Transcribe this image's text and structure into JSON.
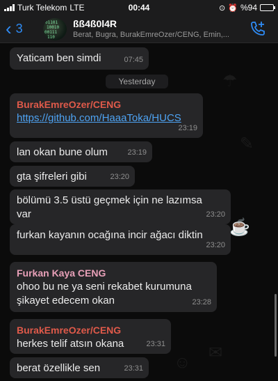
{
  "status_bar": {
    "carrier": "Turk Telekom",
    "network": "LTE",
    "time": "00:44",
    "battery": "%94",
    "battery_level": 0.94
  },
  "header": {
    "back_count": "3",
    "title": "ßß4ß0l4R",
    "subtitle": "Berat, Bugra, BurakEmreOzer/CENG, Emin,...",
    "accent_color": "#2f8cf6"
  },
  "chat": {
    "date_separator": "Yesterday",
    "messages": [
      {
        "text": "Yaticam ben simdi",
        "time": "07:45"
      },
      {
        "sender": "BurakEmreOzer/CENG",
        "sender_color": "#e05a4a",
        "link": "https://github.com/HaaaToka/HUCS",
        "time": "23:19"
      },
      {
        "text": "lan okan bune olum",
        "time": "23:19"
      },
      {
        "text": "gta şifreleri gibi",
        "time": "23:20"
      },
      {
        "text_line1": "bölümü 3.5 üstü geçmek için ne lazımsa",
        "text_line2": "var",
        "time": "23:20"
      },
      {
        "text": "furkan kayanın ocağına incir ağacı diktin",
        "time": "23:20"
      },
      {
        "sender": "Furkan Kaya CENG",
        "sender_color": "#e8a0b8",
        "text_line1": "ohoo bu ne ya seni rekabet kurumuna",
        "text_line2": "şikayet edecem okan",
        "time": "23:28"
      },
      {
        "sender": "BurakEmreOzer/CENG",
        "sender_color": "#e05a4a",
        "text": "herkes telif atsın okana",
        "time": "23:31"
      },
      {
        "text": "berat özellikle sen",
        "time": "23:31"
      }
    ]
  }
}
